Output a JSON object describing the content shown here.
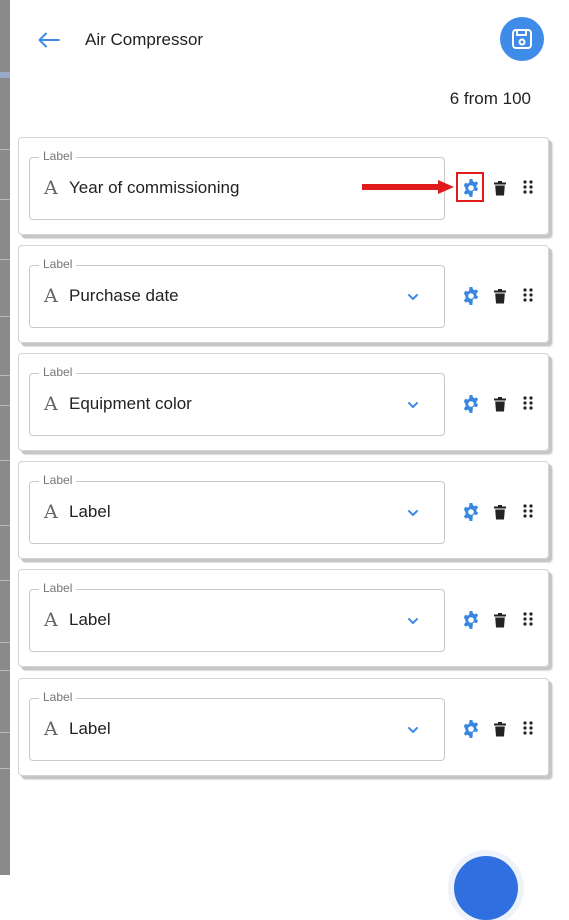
{
  "header": {
    "back_icon": "arrow-left-icon",
    "title": "Air Compressor",
    "save_icon": "floppy-disk-icon"
  },
  "counter": "6 from 100",
  "fields": [
    {
      "label": "Label",
      "value": "Year of commissioning",
      "type_icon": "A",
      "has_dropdown": false,
      "highlighted": true
    },
    {
      "label": "Label",
      "value": "Purchase date",
      "type_icon": "A",
      "has_dropdown": true,
      "highlighted": false
    },
    {
      "label": "Label",
      "value": "Equipment color",
      "type_icon": "A",
      "has_dropdown": true,
      "highlighted": false
    },
    {
      "label": "Label",
      "value": "Label",
      "type_icon": "A",
      "has_dropdown": true,
      "highlighted": false
    },
    {
      "label": "Label",
      "value": "Label",
      "type_icon": "A",
      "has_dropdown": true,
      "highlighted": false
    },
    {
      "label": "Label",
      "value": "Label",
      "type_icon": "A",
      "has_dropdown": true,
      "highlighted": false
    }
  ],
  "row_actions": [
    "gear-icon",
    "trash-icon",
    "drag-handle-icon"
  ],
  "colors": {
    "accent": "#3f8be8",
    "gear": "#3a87e0",
    "annotation": "#e11b1b"
  }
}
